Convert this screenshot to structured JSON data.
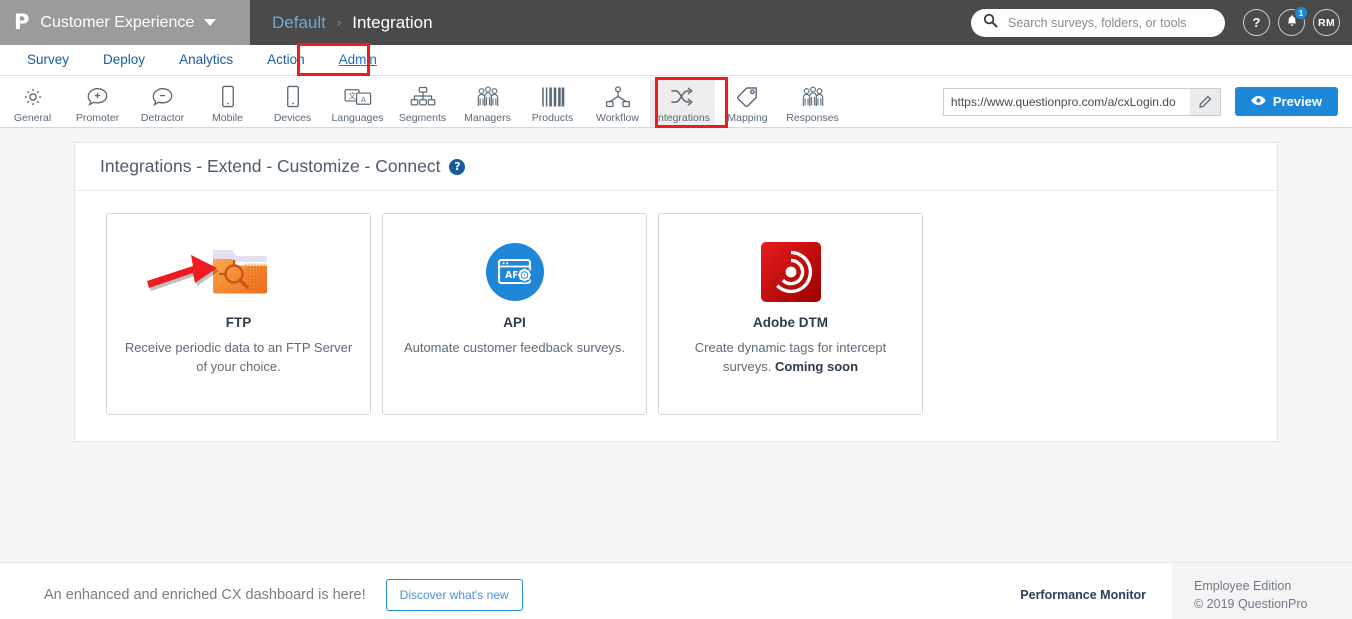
{
  "header": {
    "logo_glyph": "P",
    "brand": "Customer Experience",
    "brand_caret_icon": "chevron-down-icon",
    "breadcrumb": {
      "root": "Default",
      "separator": "›",
      "current": "Integration"
    },
    "search": {
      "placeholder": "Search surveys, folders, or tools",
      "value": "",
      "icon": "search-icon"
    },
    "help_label": "?",
    "notifications": {
      "icon": "bell-icon",
      "count": "1"
    },
    "avatar_initials": "RM"
  },
  "mainnav": {
    "items": [
      {
        "label": "Survey",
        "active": false
      },
      {
        "label": "Deploy",
        "active": false
      },
      {
        "label": "Analytics",
        "active": false
      },
      {
        "label": "Action",
        "active": false
      },
      {
        "label": "Admin",
        "active": true
      }
    ],
    "highlight_color": "#ee1c20"
  },
  "toolbar": {
    "items": [
      {
        "label": "General",
        "icon": "gear-icon",
        "selected": false
      },
      {
        "label": "Promoter",
        "icon": "plus-bubble-icon",
        "selected": false
      },
      {
        "label": "Detractor",
        "icon": "minus-bubble-icon",
        "selected": false
      },
      {
        "label": "Mobile",
        "icon": "phone-icon",
        "selected": false
      },
      {
        "label": "Devices",
        "icon": "device-icon",
        "selected": false
      },
      {
        "label": "Languages",
        "icon": "translate-icon",
        "selected": false
      },
      {
        "label": "Segments",
        "icon": "sitemap-icon",
        "selected": false
      },
      {
        "label": "Managers",
        "icon": "people-icon",
        "selected": false
      },
      {
        "label": "Products",
        "icon": "barcode-icon",
        "selected": false
      },
      {
        "label": "Workflow",
        "icon": "workflow-icon",
        "selected": false
      },
      {
        "label": "Integrations",
        "icon": "shuffle-icon",
        "selected": true
      },
      {
        "label": "Mapping",
        "icon": "tag-icon",
        "selected": false
      },
      {
        "label": "Responses",
        "icon": "people-icon",
        "selected": false
      }
    ],
    "url_value": "https://www.questionpro.com/a/cxLogin.do",
    "url_edit_icon": "pencil-icon",
    "preview_label": "Preview",
    "preview_icon": "eye-icon",
    "preview_color": "#1f87d8"
  },
  "panel": {
    "title": "Integrations - Extend - Customize - Connect",
    "help_icon": "question-mark-icon",
    "cards": [
      {
        "name": "FTP",
        "icon": "ftp-folder-icon",
        "desc": "Receive periodic data to an FTP Server of your choice.",
        "badge": "",
        "accent": "#f28a2e"
      },
      {
        "name": "API",
        "icon": "api-icon",
        "desc": "Automate customer feedback surveys.",
        "badge": "",
        "accent": "#1f87d8"
      },
      {
        "name": "Adobe DTM",
        "icon": "adobe-dtm-icon",
        "desc": "Create dynamic tags for intercept surveys. ",
        "badge": "Coming soon",
        "accent": "#cc0000"
      }
    ]
  },
  "footer": {
    "message": "An enhanced and enriched CX dashboard is here!",
    "discover_label": "Discover what's new",
    "performance_monitor": "Performance Monitor",
    "edition": "Employee Edition",
    "copyright": "© 2019 QuestionPro"
  }
}
